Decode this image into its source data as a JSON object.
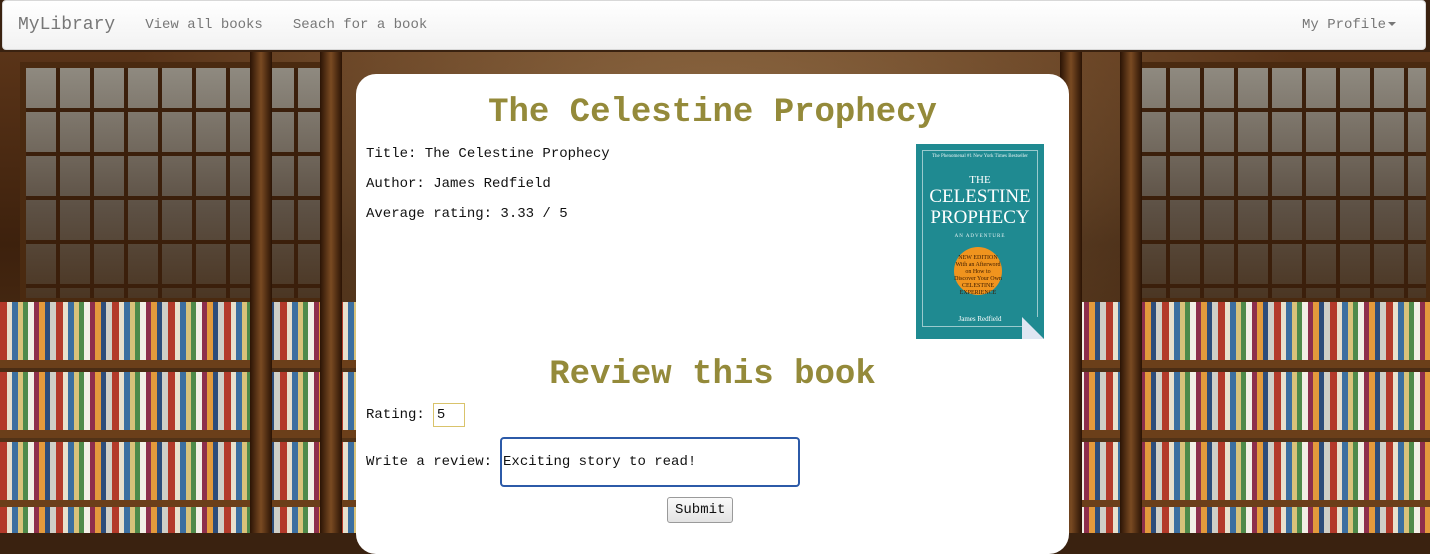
{
  "navbar": {
    "brand": "MyLibrary",
    "links": [
      "View all books",
      "Seach for a book"
    ],
    "profile": "My Profile"
  },
  "book": {
    "heading": "The Celestine Prophecy",
    "title_line": "Title: The Celestine Prophecy",
    "author_line": "Author: James Redfield",
    "rating_line": "Average rating: 3.33 / 5",
    "cover": {
      "top_text": "The Phenomenal #1 New York Times Bestseller",
      "the": "THE",
      "title": "CELESTINE PROPHECY",
      "subtitle": "AN ADVENTURE",
      "badge": "NEW EDITION With an Afterword on How to Discover Your Own CELESTINE EXPERIENCE",
      "author": "James Redfield",
      "color": "#1f8a91"
    }
  },
  "review": {
    "heading": "Review this book",
    "rating_label": "Rating:",
    "rating_value": "5",
    "review_label": "Write a review:",
    "review_value": "Exciting story to read! ",
    "submit_label": "Submit"
  },
  "colors": {
    "heading": "#948a3a",
    "focus_border": "#2c5aa8"
  }
}
